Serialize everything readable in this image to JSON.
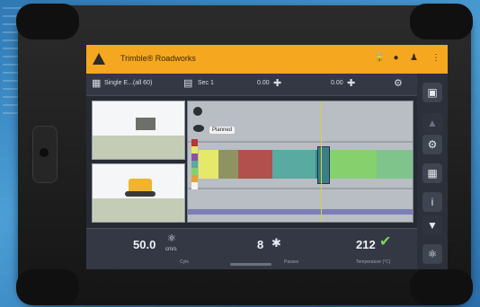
{
  "app": {
    "title": "Trimble® Roadworks",
    "header_icons": [
      "lock-icon",
      "bell-icon",
      "person-icon",
      "more-icon"
    ]
  },
  "toolbar": {
    "design_label": "Single E...(all 60)",
    "surface_label": "Sec 1",
    "offset_left_value": "0.00",
    "offset_right_value": "0.00"
  },
  "main_view": {
    "tag_label": "Planned",
    "segment_colors": [
      "#e6e86a",
      "#8e9461",
      "#b2504d",
      "#59aaa0",
      "#2f8f8a",
      "#86d06e",
      "#7fc48a"
    ]
  },
  "bottom_bar": {
    "left_value": "50.0",
    "left_unit": "cm/s",
    "left_label": "Cyls",
    "mid_value": "8",
    "mid_label": "Passes",
    "right_value": "212",
    "right_label": "Temperature (°C)"
  },
  "colors": {
    "accent": "#f5a81f",
    "panel": "#333844",
    "screen_bg": "#262a33"
  }
}
